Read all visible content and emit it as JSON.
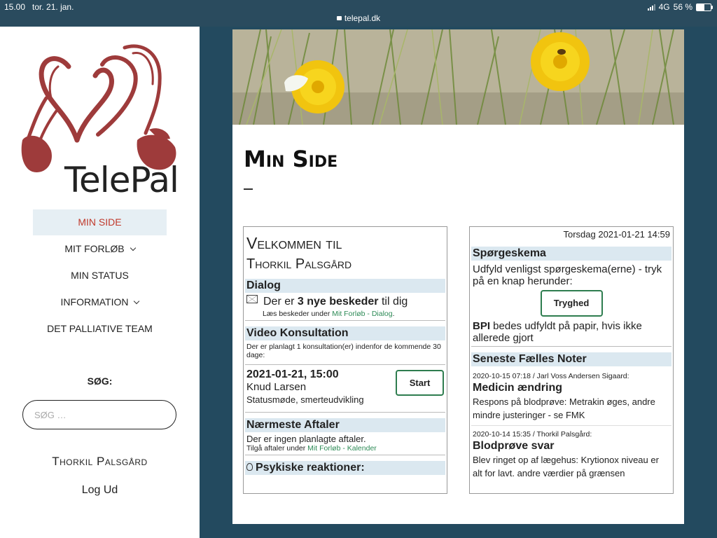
{
  "statusbar": {
    "time": "15.00",
    "date": "tor. 21. jan.",
    "url": "telepal.dk",
    "network": "4G",
    "battery": "56 %",
    "battery_level": 0.56
  },
  "sidebar": {
    "logo_text": "TelePal",
    "nav": [
      {
        "label": "MIN SIDE",
        "active": true
      },
      {
        "label": "MIT FORLØB",
        "dropdown": true
      },
      {
        "label": "MIN STATUS"
      },
      {
        "label": "INFORMATION",
        "dropdown": true
      },
      {
        "label": "DET PALLIATIVE TEAM"
      }
    ],
    "search_label": "SØG:",
    "search_placeholder": "SØG …",
    "user_name": "Thorkil Palsgård",
    "logout": "Log Ud"
  },
  "main": {
    "title": "Min Side",
    "left": {
      "welcome_line1": "Velkommen til",
      "welcome_line2": "Thorkil Palsgård",
      "dialog": {
        "heading": "Dialog",
        "msg_pre": "Der er ",
        "msg_bold": "3 nye beskeder",
        "msg_post": " til dig",
        "sub_pre": "Læs beskeder under ",
        "sub_link": "Mit Forløb - Dialog",
        "sub_post": "."
      },
      "video": {
        "heading": "Video Konsultation",
        "info": "Der er planlagt 1 konsultation(er) indenfor de kommende 30 dage:",
        "datetime": "2021-01-21, 15:00",
        "person": "Knud Larsen",
        "topic": "Statusmøde, smerteudvikling",
        "start_label": "Start"
      },
      "appointments": {
        "heading": "Nærmeste Aftaler",
        "none": "Der er ingen planlagte aftaler.",
        "sub_pre": "Tilgå aftaler under ",
        "sub_link": "Mit Forløb - Kalender"
      },
      "psych": {
        "heading": "Psykiske reaktioner:"
      }
    },
    "right": {
      "datetime": "Torsdag 2021-01-21 14:59",
      "survey": {
        "heading": "Spørgeskema",
        "text": "Udfyld venligst spørgeskema(erne) - tryk på en knap herunder:",
        "button": "Tryghed",
        "bpi_bold": "BPI",
        "bpi_text": " bedes udfyldt på papir, hvis ikke allerede gjort"
      },
      "notes": {
        "heading": "Seneste Fælles Noter",
        "items": [
          {
            "meta": "2020-10-15 07:18 / Jarl Voss Andersen Sigaard:",
            "title": "Medicin ændring",
            "body": "Respons på blodprøve: Metrakin øges, andre mindre justeringer - se FMK"
          },
          {
            "meta": "2020-10-14 15:35 / Thorkil Palsgård:",
            "title": "Blodprøve svar",
            "body": "Blev ringet op af lægehus: Krytionox niveau er alt for lavt. andre værdier på grænsen"
          }
        ]
      }
    }
  },
  "colors": {
    "page_bg": "#234a5f",
    "accent_red": "#c0392b",
    "link_green": "#2e8b57",
    "section_bg": "#dbe8f0",
    "logo_red": "#9e3b3b"
  }
}
